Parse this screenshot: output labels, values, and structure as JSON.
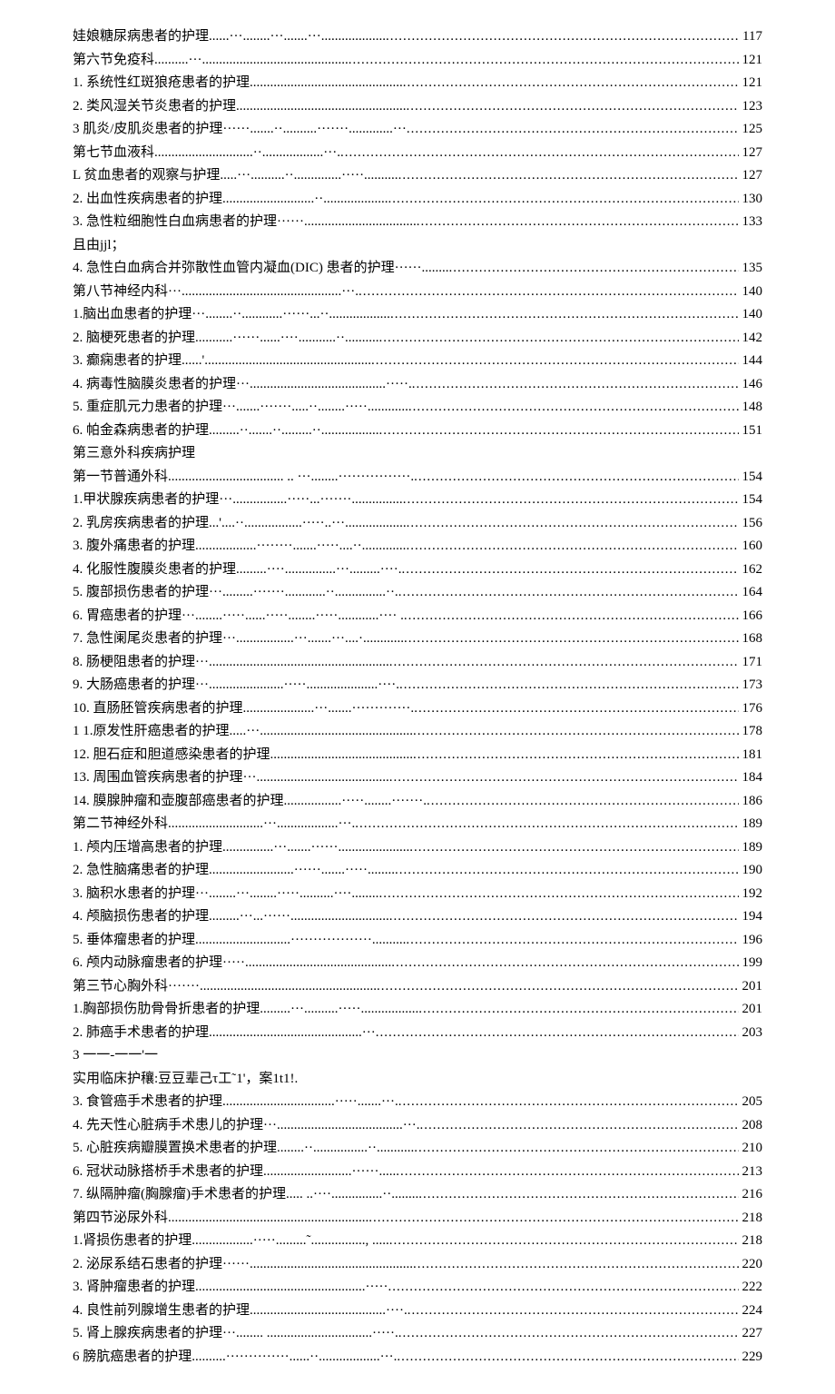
{
  "toc": [
    {
      "title": "娃娘糖尿病患者的护理......···........···.......···...................",
      "page": "117"
    },
    {
      "title": "第六节免疫科..........···...........................................",
      "page": "121"
    },
    {
      "title": "1. 系统性红斑狼疮患者的护理.............................................",
      "page": "121"
    },
    {
      "title": "2.  类风湿关节炎患者的护理..................................................",
      "page": "123"
    },
    {
      "title": "3 肌炎/皮肌炎患者的护理······.......··..........·······.............···",
      "page": "125"
    },
    {
      "title": "第七节血液科.............................··..................···.",
      "page": "127"
    },
    {
      "title": "L 贫血患者的观察与护理.....···..........··..............·····..........",
      "page": "127"
    },
    {
      "title": "2.  出血性疾病患者的护理...........................··...................",
      "page": "130"
    },
    {
      "title": "3.  急性粒细胞性白血病患者的护理······.................................",
      "page": "133"
    },
    {
      "title": "且由jjl；",
      "page": null
    },
    {
      "title": "4.  急性白血病合并弥散性血管内凝血(DIC)  患者的护理······........",
      "page": "135"
    },
    {
      "title": "第八节神经内科···...............................................···.",
      "page": "140"
    },
    {
      "title": "1.脑出血患者的护理···........··............······...··..................",
      "page": "140"
    },
    {
      "title": "2.  脑梗死患者的护理...........······......····...........··..........",
      "page": "142"
    },
    {
      "title": "3.  癫痫患者的护理......'.................................................",
      "page": "144"
    },
    {
      "title": "4.  病毒性脑膜炎患者的护理···........................................·····.",
      "page": "146"
    },
    {
      "title": "5.  重症肌元力患者的护理···.......·······.....··........·····............",
      "page": "148"
    },
    {
      "title": "6.  帕金森病患者的护理.........··.......··.........··.................",
      "page": "151"
    },
    {
      "title": "第三意外科疾病护理",
      "page": null
    },
    {
      "title": "第一节普通外科.................................. .. ···........················.",
      "page": "154"
    },
    {
      "title": "1.甲状腺疾病患者的护理···................·····...·······...............",
      "page": "154"
    },
    {
      "title": "2.  乳房疾病患者的护理...'....··.................·····..···..................",
      "page": "156"
    },
    {
      "title": "3.  腹外痛患者的护理..................········.......·····....··.............",
      "page": "160"
    },
    {
      "title": "4.  化服性腹膜炎患者的护理.........····...............···.........····.",
      "page": "162"
    },
    {
      "title": "5.  腹部损伤患者的护理···.........·······............··...............··.",
      "page": "164"
    },
    {
      "title": "6.  胃癌患者的护理···........·····......·····........·····............···· .",
      "page": "166"
    },
    {
      "title": "7.  急性阑尾炎患者的护理···.................···.......···....·............",
      "page": "168"
    },
    {
      "title": "8.  肠梗阻患者的护理···.....................................................",
      "page": "171"
    },
    {
      "title": "9.  大肠癌患者的护理···......................·····.....................····.",
      "page": "173"
    },
    {
      "title": "10.  直肠胚管疾病患者的护理.....................···.......·············.",
      "page": "176"
    },
    {
      "title": "1 1.原发性肝癌患者的护理.....···.............................................",
      "page": "178"
    },
    {
      "title": "12.  胆石症和胆道感染患者的护理..........................................",
      "page": "181"
    },
    {
      "title": "13.  周围血管疾病患者的护理···.......................................",
      "page": "184"
    },
    {
      "title": "14.  膜腺肿瘤和壶腹部癌患者的护理.................·····........·······.",
      "page": "186"
    },
    {
      "title": "第二节神经外科............................···..................···.",
      "page": "189"
    },
    {
      "title": "1.  颅内压增高患者的护理...............···.......······.....................",
      "page": "189"
    },
    {
      "title": "2.  急性脑痛患者的护理.........................······.......·····........",
      "page": "190"
    },
    {
      "title": "3.  脑积水患者的护理···........···........·····..........····........",
      "page": "192"
    },
    {
      "title": "4.  颅脑损伤患者的护理.........···...······.............................",
      "page": "194"
    },
    {
      "title": "5.  垂体瘤患者的护理............................··················..........",
      "page": "196"
    },
    {
      "title": "6.  颅内动脉瘤患者的护理·····...........................................",
      "page": "199"
    },
    {
      "title": "第三节心胸外科·······....................................................",
      "page": "201"
    },
    {
      "title": "1.胸部损伤肋骨骨折患者的护理.........···..........·····.................",
      "page": "201"
    },
    {
      "title": "2. 肺癌手术患者的护理.............................................···",
      "page": "203"
    },
    {
      "title": "3 一一-一一'一",
      "page": null
    },
    {
      "title": "实用临床护穰:豆豆辈己τ工˜1'，案1t1!.",
      "page": null
    },
    {
      "title": "3.  食管癌手术患者的护理.................................·····.......···.",
      "page": "205"
    },
    {
      "title": "4.  先天性心脏病手术患儿的护理···.....................................···.",
      "page": "208"
    },
    {
      "title": "5.  心脏疾病瓣膜置换术患者的护理........··................··...........",
      "page": "210"
    },
    {
      "title": "6.  冠状动脉搭桥手术患者的护理..........................······.....",
      "page": "213"
    },
    {
      "title": "7.  纵隔肿瘤(胸腺瘤)手术患者的护理..... ..····...............··........",
      "page": "216"
    },
    {
      "title": "第四节泌尿外科...........................................................",
      "page": "218"
    },
    {
      "title": "1.肾损伤患者的护理..................·····.........˜................,  .....",
      "page": "218"
    },
    {
      "title": "2.  泌尿系结石患者的护理······................................................",
      "page": "220"
    },
    {
      "title": "3.  肾肿瘤患者的护理..................................................·····",
      "page": "222"
    },
    {
      "title": "4.  良性前列腺增生患者的护理........................................····.",
      "page": "224"
    },
    {
      "title": "5.  肾上腺疾病患者的护理···........ ...............................·····.",
      "page": "227"
    },
    {
      "title": "6 膀肮癌患者的护理..........··············......··..................···.",
      "page": "229"
    }
  ]
}
